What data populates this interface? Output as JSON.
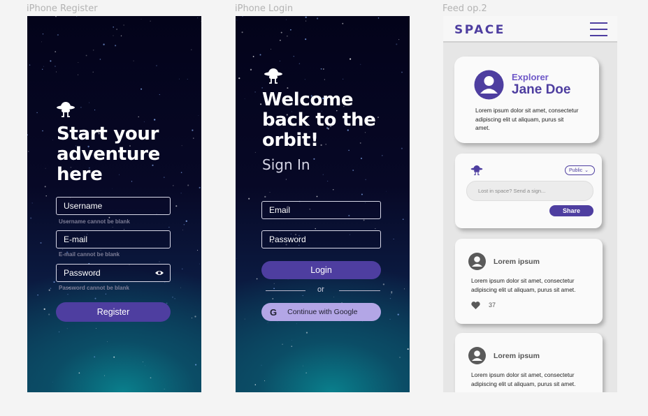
{
  "frames": {
    "register_label": "iPhone Register",
    "login_label": "iPhone Login",
    "feed_label": "Feed op.2"
  },
  "register": {
    "headline": [
      "Start your",
      "adventure",
      "here"
    ],
    "username_placeholder": "Username",
    "username_error": "Username cannot be blank",
    "email_placeholder": "E-mail",
    "email_error": "E-mail cannot be blank",
    "password_placeholder": "Password",
    "password_error": "Password cannot be blank",
    "submit_label": "Register"
  },
  "login": {
    "headline": [
      "Welcome",
      "back to the",
      "orbit!"
    ],
    "subtitle": "Sign  In",
    "email_placeholder": "Email",
    "password_placeholder": "Password",
    "submit_label": "Login",
    "divider_text": "or",
    "google_label": "Continue with Google",
    "google_glyph": "G"
  },
  "feed": {
    "brand": "SPACE",
    "profile": {
      "role": "Explorer",
      "name": "Jane Doe",
      "bio": [
        "Lorem ipsum dolor sit amet, consectetur",
        "adipiscing elit ut aliquam, purus sit",
        "amet."
      ]
    },
    "composer": {
      "visibility": "Public",
      "placeholder": "Lost in space? Send a sign...",
      "share_label": "Share"
    },
    "posts": [
      {
        "author": "Lorem ipsum",
        "body": [
          "Lorem ipsum dolor sit amet, consectetur",
          "adipiscing elit ut aliquam, purus sit amet."
        ],
        "likes": "37"
      },
      {
        "author": "Lorem ipsum",
        "body": [
          "Lorem ipsum dolor sit amet, consectetur",
          "adipiscing elit ut aliquam, purus sit amet."
        ]
      }
    ]
  },
  "colors": {
    "accent": "#4e3ea0",
    "google_button": "#b3a6e6",
    "feed_bg": "#e6e6e6"
  }
}
